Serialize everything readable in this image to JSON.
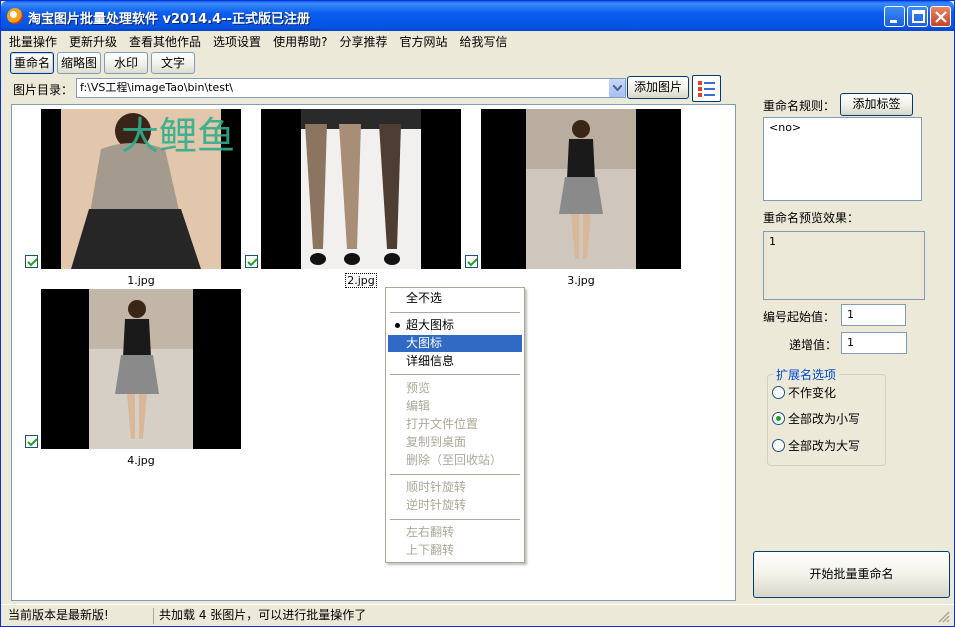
{
  "window": {
    "title": "淘宝图片批量处理软件  v2014.4--正式版已注册"
  },
  "menu": [
    "批量操作",
    "更新升级",
    "查看其他作品",
    "选项设置",
    "使用帮助?",
    "分享推荐",
    "官方网站",
    "给我写信"
  ],
  "tabs": [
    "重命名",
    "缩略图",
    "水印",
    "文字"
  ],
  "directory": {
    "label": "图片目录：",
    "path": "f:\\VS工程\\imageTao\\bin\\test\\",
    "add_button": "添加图片"
  },
  "images": [
    {
      "name": "1.jpg",
      "checked": true,
      "watermark": "大鲤鱼"
    },
    {
      "name": "2.jpg",
      "checked": true
    },
    {
      "name": "3.jpg",
      "checked": true
    },
    {
      "name": "4.jpg",
      "checked": true
    }
  ],
  "context_menu": {
    "items": [
      "全不选",
      "超大图标",
      "大图标",
      "详细信息",
      "预览",
      "编辑",
      "打开文件位置",
      "复制到桌面",
      "删除（至回收站）",
      "顺时针旋转",
      "逆时针旋转",
      "左右翻转",
      "上下翻转"
    ],
    "selected": "超大图标",
    "highlighted": "大图标"
  },
  "rename": {
    "rule_label": "重命名规则：",
    "add_tag_button": "添加标签",
    "rule_value": "<no>",
    "preview_label": "重命名预览效果：",
    "preview_value": "1",
    "start_label": "编号起始值：",
    "start_value": "1",
    "step_label": "递增值：",
    "step_value": "1",
    "ext_group": "扩展名选项",
    "ext_options": [
      "不作变化",
      "全部改为小写",
      "全部改为大写"
    ],
    "ext_selected": "全部改为小写",
    "start_button": "开始批量重命名"
  },
  "status": {
    "left": "当前版本是最新版!",
    "right": "共加载 4 张图片，可以进行批量操作了"
  },
  "colors": {
    "titlebar": "#0a5ef0",
    "highlight": "#316ac5",
    "face": "#ece9d8",
    "check_green": "#21a121"
  }
}
